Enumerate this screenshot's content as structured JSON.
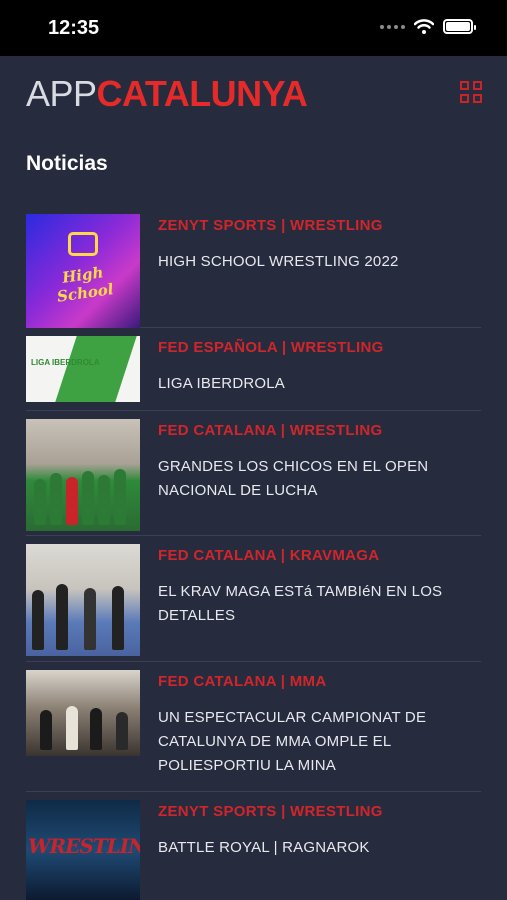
{
  "status_bar": {
    "time": "12:35"
  },
  "header": {
    "logo_light": "APP",
    "logo_bold": "CATALUNYA"
  },
  "section_title": "Noticias",
  "news": [
    {
      "source": "ZENYT SPORTS | WRESTLING",
      "title": "HIGH SCHOOL WRESTLING 2022",
      "thumb_text": "High School"
    },
    {
      "source": "FED ESPAÑOLA | WRESTLING",
      "title": "LIGA IBERDROLA",
      "thumb_text": "LIGA IBERDROLA"
    },
    {
      "source": "FED CATALANA | WRESTLING",
      "title": "GRANDES LOS CHICOS EN EL OPEN NACIONAL DE LUCHA"
    },
    {
      "source": "FED CATALANA | KRAVMAGA",
      "title": "EL KRAV MAGA ESTá TAMBIéN EN LOS DETALLES"
    },
    {
      "source": "FED CATALANA | MMA",
      "title": "UN ESPECTACULAR CAMPIONAT DE CATALUNYA DE MMA OMPLE EL POLIESPORTIU LA MINA"
    },
    {
      "source": "ZENYT SPORTS | WRESTLING",
      "title": "BATTLE ROYAL | RAGNAROK",
      "thumb_text": "WRESTLING"
    }
  ],
  "colors": {
    "background": "#262b3d",
    "accent": "#e52a2a",
    "status_bar": "#000000"
  }
}
